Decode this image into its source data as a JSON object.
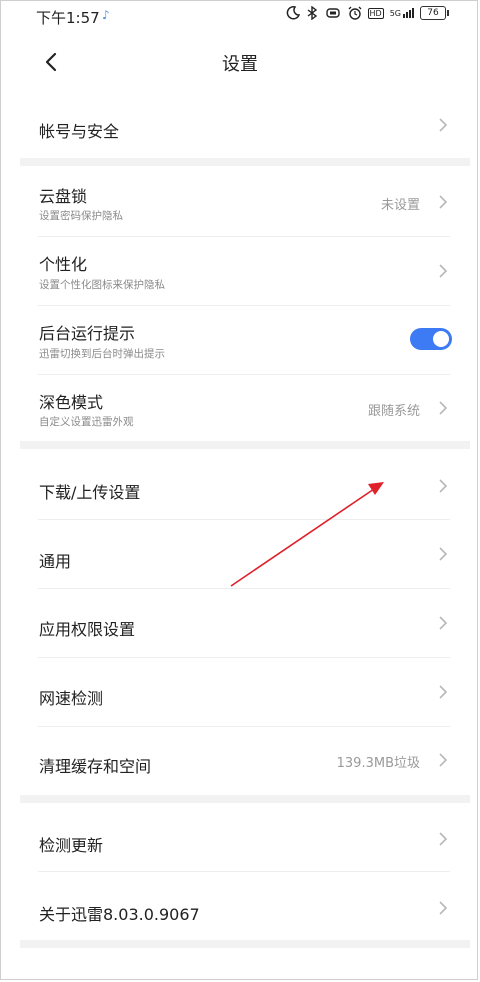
{
  "status_bar": {
    "time": "下午1:57",
    "music_note": "♪",
    "hd": "HD",
    "network": "5G",
    "battery": "76"
  },
  "header": {
    "title": "设置"
  },
  "groups": {
    "account": {
      "label": "帐号与安全"
    },
    "cloud_lock": {
      "label": "云盘锁",
      "sub": "设置密码保护隐私",
      "value": "未设置"
    },
    "personalize": {
      "label": "个性化",
      "sub": "设置个性化图标来保护隐私"
    },
    "background_tip": {
      "label": "后台运行提示",
      "sub": "迅雷切换到后台时弹出提示",
      "enabled": true
    },
    "dark_mode": {
      "label": "深色模式",
      "sub": "自定义设置迅雷外观",
      "value": "跟随系统"
    },
    "download_upload": {
      "label": "下载/上传设置"
    },
    "general": {
      "label": "通用"
    },
    "permissions": {
      "label": "应用权限设置"
    },
    "speed_test": {
      "label": "网速检测"
    },
    "cache": {
      "label": "清理缓存和空间",
      "value": "139.3MB垃圾"
    },
    "update": {
      "label": "检测更新"
    },
    "about": {
      "label": "关于迅雷8.03.0.9067"
    }
  },
  "annotation_color": "#e0202a"
}
